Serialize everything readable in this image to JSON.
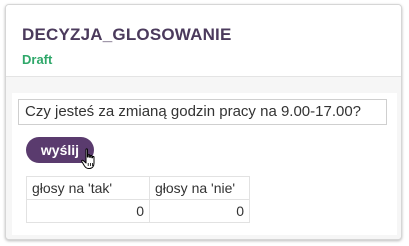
{
  "card": {
    "title": "DECYZJA_GLOSOWANIE",
    "status": "Draft",
    "status_color": "#2fa86a",
    "title_color": "#4b3a5c"
  },
  "form": {
    "question": "Czy jesteś za zmianą godzin pracy na 9.00-17.00?",
    "send_label": "wyślij",
    "send_color": "#5a3b6e"
  },
  "results": {
    "headers": [
      "głosy na 'tak'",
      "głosy na 'nie'"
    ],
    "values": [
      "0",
      "0"
    ]
  },
  "cursor": {
    "icon": "hand-pointer-icon"
  }
}
